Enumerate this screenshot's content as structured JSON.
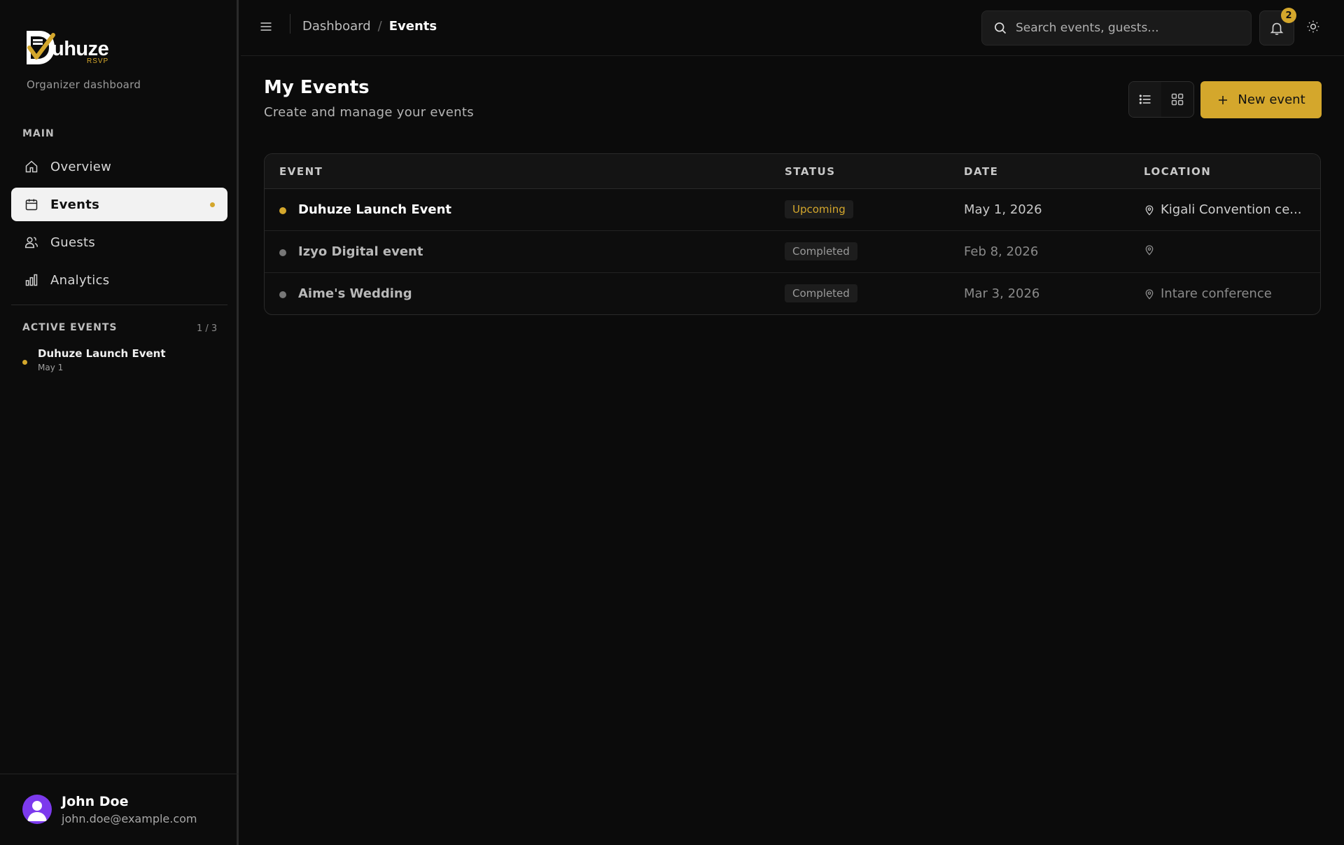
{
  "app": {
    "brand": "uhuze",
    "brand_sub": "RSVP",
    "subtitle": "Organizer dashboard"
  },
  "sidebar": {
    "main_label": "MAIN",
    "items": [
      {
        "label": "Overview",
        "icon": "home-icon"
      },
      {
        "label": "Events",
        "icon": "calendar-icon",
        "active": true
      },
      {
        "label": "Guests",
        "icon": "users-icon"
      },
      {
        "label": "Analytics",
        "icon": "bar-chart-icon"
      }
    ],
    "active_events_label": "ACTIVE EVENTS",
    "active_events_count": "1 / 3",
    "active_events": [
      {
        "title": "Duhuze Launch Event",
        "date": "May 1"
      }
    ]
  },
  "user": {
    "name": "John Doe",
    "email": "john.doe@example.com"
  },
  "header": {
    "breadcrumb_root": "Dashboard",
    "breadcrumb_sep": "/",
    "breadcrumb_current": "Events",
    "search_placeholder": "Search events, guests...",
    "notification_count": "2"
  },
  "main": {
    "title": "My Events",
    "subtitle": "Create and manage your events",
    "new_button": "New event"
  },
  "table": {
    "columns": [
      "EVENT",
      "STATUS",
      "DATE",
      "LOCATION"
    ],
    "rows": [
      {
        "name": "Duhuze Launch Event",
        "status": "Upcoming",
        "date": "May 1, 2026",
        "location": "Kigali Convention ce..."
      },
      {
        "name": "Izyo Digital event",
        "status": "Completed",
        "date": "Feb 8, 2026",
        "location": ""
      },
      {
        "name": "Aime's Wedding",
        "status": "Completed",
        "date": "Mar 3, 2026",
        "location": "Intare conference"
      }
    ]
  },
  "colors": {
    "accent": "#d4a72c",
    "background": "#0b0b0b",
    "avatar": "#7c3aed"
  }
}
